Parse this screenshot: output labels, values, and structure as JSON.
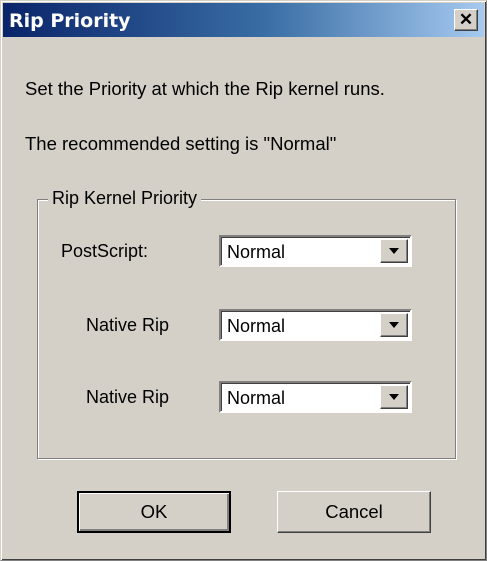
{
  "window": {
    "title": "Rip Priority",
    "close_glyph": "✕"
  },
  "description": {
    "line1": "Set the Priority at which the Rip kernel runs.",
    "line2": "The recommended setting is \"Normal\""
  },
  "group": {
    "legend": "Rip Kernel Priority",
    "rows": [
      {
        "label": "PostScript:",
        "value": "Normal"
      },
      {
        "label": "Native Rip",
        "value": "Normal"
      },
      {
        "label": "Native Rip",
        "value": "Normal"
      }
    ]
  },
  "buttons": {
    "ok_label": "OK",
    "cancel_label": "Cancel"
  },
  "colors": {
    "title_gradient_start": "#0a246a",
    "title_gradient_end": "#a6caf0",
    "dialog_face": "#d4d0c8"
  }
}
